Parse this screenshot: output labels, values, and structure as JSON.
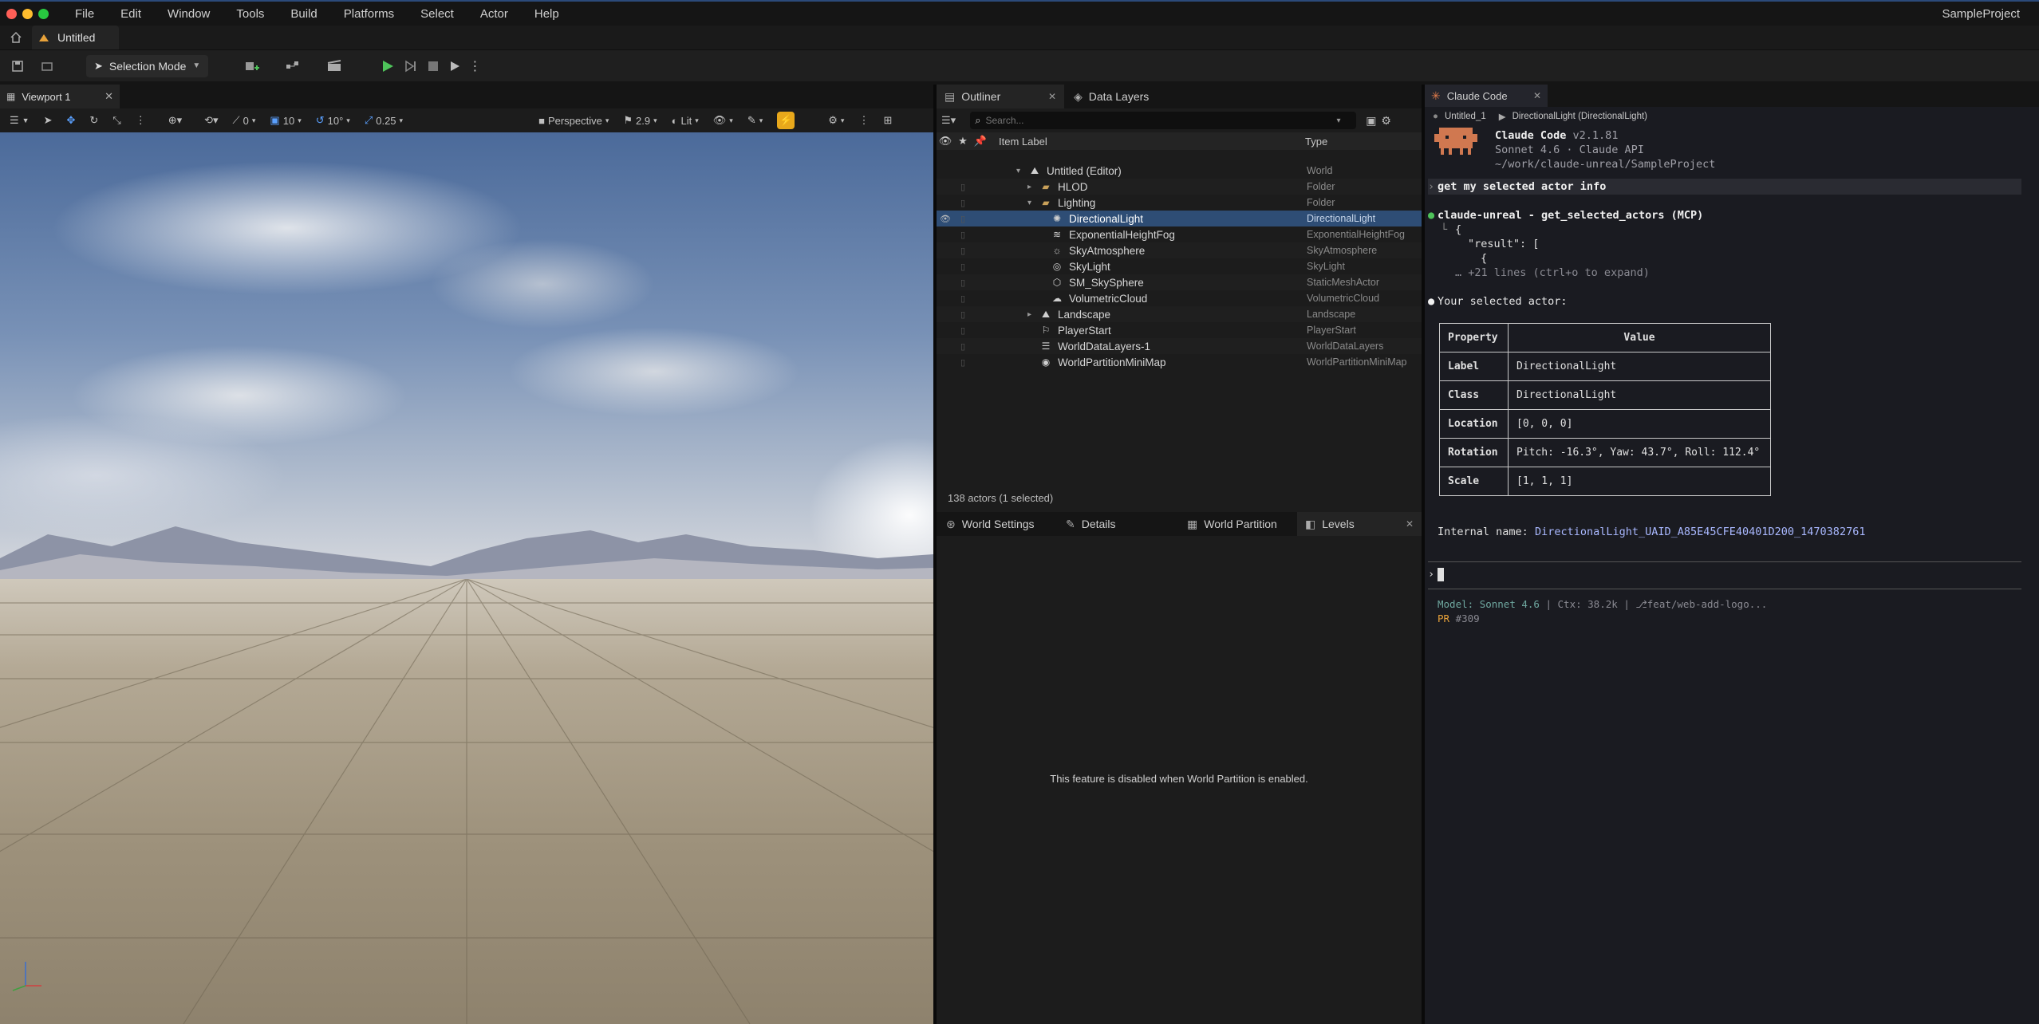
{
  "menubar": {
    "items": [
      "File",
      "Edit",
      "Window",
      "Tools",
      "Build",
      "Platforms",
      "Select",
      "Actor",
      "Help"
    ],
    "project": "SampleProject"
  },
  "tabbar": {
    "level_tab": "Untitled"
  },
  "toolbar": {
    "selection_mode": "Selection Mode"
  },
  "viewport": {
    "tab": "Viewport 1",
    "angle_snap": "0",
    "grid_snap": "10",
    "rot_snap": "10°",
    "scale_snap": "0.25",
    "view_mode": "Perspective",
    "camera_speed": "2.9",
    "lighting": "Lit"
  },
  "outliner": {
    "tab": "Outliner",
    "tab2": "Data Layers",
    "search_placeholder": "Search...",
    "col_label": "Item Label",
    "col_type": "Type",
    "rows": [
      {
        "label": "Untitled (Editor)",
        "type": "World"
      },
      {
        "label": "HLOD",
        "type": "Folder"
      },
      {
        "label": "Lighting",
        "type": "Folder"
      },
      {
        "label": "DirectionalLight",
        "type": "DirectionalLight"
      },
      {
        "label": "ExponentialHeightFog",
        "type": "ExponentialHeightFog"
      },
      {
        "label": "SkyAtmosphere",
        "type": "SkyAtmosphere"
      },
      {
        "label": "SkyLight",
        "type": "SkyLight"
      },
      {
        "label": "SM_SkySphere",
        "type": "StaticMeshActor"
      },
      {
        "label": "VolumetricCloud",
        "type": "VolumetricCloud"
      },
      {
        "label": "Landscape",
        "type": "Landscape"
      },
      {
        "label": "PlayerStart",
        "type": "PlayerStart"
      },
      {
        "label": "WorldDataLayers-1",
        "type": "WorldDataLayers"
      },
      {
        "label": "WorldPartitionMiniMap",
        "type": "WorldPartitionMiniMap"
      }
    ],
    "status": "138 actors (1 selected)"
  },
  "bottom_panel": {
    "tabs": [
      "World Settings",
      "Details",
      "World Partition",
      "Levels"
    ],
    "message": "This feature is disabled when World Partition is enabled."
  },
  "claude": {
    "tab": "Claude Code",
    "crumb1": "Untitled_1",
    "crumb2": "DirectionalLight (DirectionalLight)",
    "app_name": "Claude Code",
    "version": "v2.1.81",
    "model_line": "Sonnet 4.6 · Claude API",
    "path": "~/work/claude-unreal/SampleProject",
    "prompt": "get my selected actor info",
    "tool_call": "claude-unreal - get_selected_actors (MCP)",
    "json1": "{",
    "json2": "\"result\": [",
    "json3": "{",
    "more_lines": "… +21 lines (ctrl+o to expand)",
    "answer": "Your selected actor:",
    "table_head": [
      "Property",
      "Value"
    ],
    "table_rows": [
      {
        "k": "Label",
        "v": "DirectionalLight"
      },
      {
        "k": "Class",
        "v": "DirectionalLight"
      },
      {
        "k": "Location",
        "v": "[0, 0, 0]"
      },
      {
        "k": "Rotation",
        "v": "Pitch: -16.3°, Yaw: 43.7°, Roll: 112.4°"
      },
      {
        "k": "Scale",
        "v": "[1, 1, 1]"
      }
    ],
    "internal_label": "Internal name:",
    "internal_value": "DirectionalLight_UAID_A85E45CFE40401D200_1470382761",
    "status_model_label": "Model:",
    "status_model": "Sonnet 4.6",
    "status_ctx": "Ctx: 38.2k",
    "status_branch": "feat/web-add-logo...",
    "pr_label": "PR",
    "pr_number": "#309"
  },
  "colors": {
    "accent": "#2b7fd3",
    "selection": "#2e4d75",
    "play": "#4ec35a",
    "claude_orange": "#e07a4a",
    "link": "#a9b8ff"
  }
}
